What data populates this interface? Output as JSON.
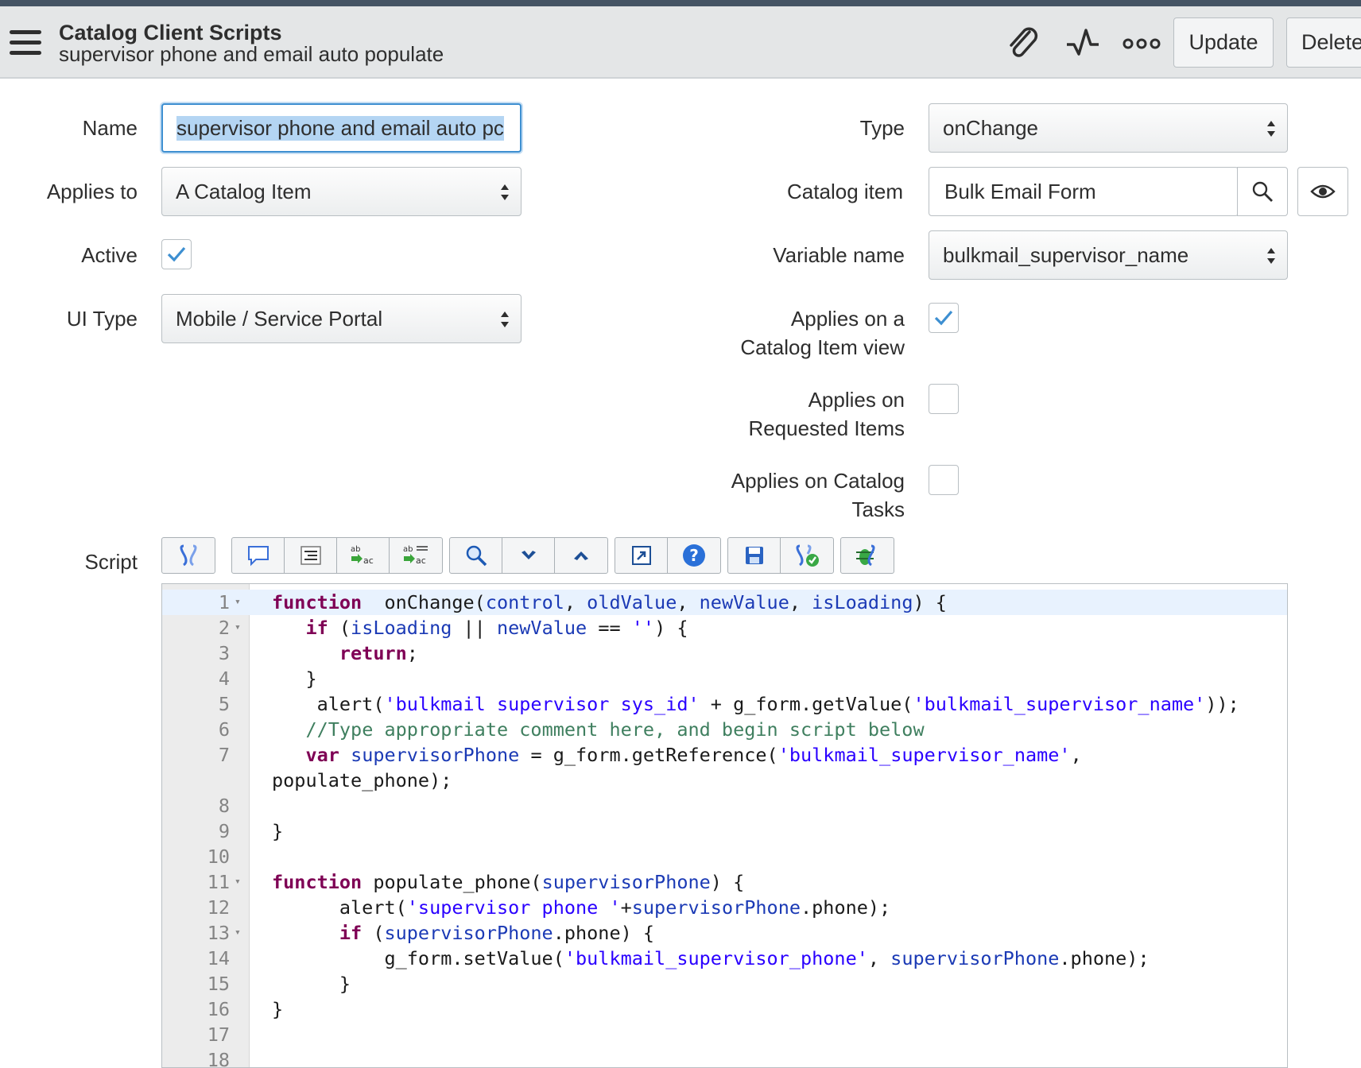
{
  "header": {
    "title": "Catalog Client Scripts",
    "subtitle": "supervisor phone and email auto populate",
    "update_label": "Update",
    "delete_label": "Delete",
    "icons": [
      "menu-icon",
      "paperclip-icon",
      "activity-icon",
      "more-options-icon"
    ]
  },
  "form": {
    "name": {
      "label": "Name",
      "value": "supervisor phone and email auto pc"
    },
    "applies_to": {
      "label": "Applies to",
      "value": "A Catalog Item"
    },
    "active": {
      "label": "Active",
      "checked": true
    },
    "ui_type": {
      "label": "UI Type",
      "value": "Mobile / Service Portal"
    },
    "type": {
      "label": "Type",
      "value": "onChange"
    },
    "catalog_item": {
      "label": "Catalog item",
      "value": "Bulk Email Form"
    },
    "variable_name": {
      "label": "Variable name",
      "value": "bulkmail_supervisor_name"
    },
    "applies_catalog_item_view": {
      "label_line1": "Applies on a",
      "label_line2": "Catalog Item view",
      "checked": true
    },
    "applies_requested_items": {
      "label_line1": "Applies on",
      "label_line2": "Requested Items",
      "checked": false
    },
    "applies_catalog_tasks": {
      "label_line1": "Applies on Catalog",
      "label_line2": "Tasks",
      "checked": false
    },
    "script_label": "Script"
  },
  "accent_color": "#3d8fd1",
  "toolbar_icons": [
    [
      "format-code-icon"
    ],
    [
      "comment-icon",
      "indent-icon",
      "replace-icon",
      "replace-all-icon"
    ],
    [
      "search-icon",
      "next-icon",
      "previous-icon"
    ],
    [
      "fullscreen-icon",
      "help-icon"
    ],
    [
      "save-icon",
      "syntax-check-icon"
    ],
    [
      "debug-icon"
    ]
  ],
  "code": {
    "lines": [
      {
        "n": "1",
        "fold": true,
        "hl": true,
        "tokens": [
          [
            "kw",
            "function"
          ],
          [
            "",
            "  onChange("
          ],
          [
            "var",
            "control"
          ],
          [
            "",
            ", "
          ],
          [
            "var",
            "oldValue"
          ],
          [
            "",
            ", "
          ],
          [
            "var",
            "newValue"
          ],
          [
            "",
            ", "
          ],
          [
            "var",
            "isLoading"
          ],
          [
            "",
            ") {"
          ]
        ]
      },
      {
        "n": "2",
        "fold": true,
        "tokens": [
          [
            "",
            "   "
          ],
          [
            "kw",
            "if"
          ],
          [
            "",
            " ("
          ],
          [
            "var",
            "isLoading"
          ],
          [
            "",
            " || "
          ],
          [
            "var",
            "newValue"
          ],
          [
            "",
            " == "
          ],
          [
            "str",
            "''"
          ],
          [
            "",
            ") {"
          ]
        ]
      },
      {
        "n": "3",
        "tokens": [
          [
            "",
            "      "
          ],
          [
            "kw",
            "return"
          ],
          [
            "",
            ";"
          ]
        ]
      },
      {
        "n": "4",
        "tokens": [
          [
            "",
            "   }"
          ]
        ]
      },
      {
        "n": "5",
        "tokens": [
          [
            "",
            "    alert("
          ],
          [
            "str",
            "'bulkmail supervisor sys_id'"
          ],
          [
            "",
            " + g_form.getValue("
          ],
          [
            "str",
            "'bulkmail_supervisor_name'"
          ],
          [
            "",
            "));"
          ]
        ]
      },
      {
        "n": "6",
        "tokens": [
          [
            "",
            "   "
          ],
          [
            "cm",
            "//Type appropriate comment here, and begin script below"
          ]
        ]
      },
      {
        "n": "7",
        "tokens": [
          [
            "",
            "   "
          ],
          [
            "kw",
            "var"
          ],
          [
            "",
            " "
          ],
          [
            "var",
            "supervisorPhone"
          ],
          [
            "",
            " = g_form.getReference("
          ],
          [
            "str",
            "'bulkmail_supervisor_name'"
          ],
          [
            "",
            ","
          ]
        ]
      },
      {
        "n": "",
        "tokens": [
          [
            "",
            "populate_phone);"
          ]
        ]
      },
      {
        "n": "8",
        "tokens": []
      },
      {
        "n": "9",
        "tokens": [
          [
            "",
            "}"
          ]
        ]
      },
      {
        "n": "10",
        "tokens": []
      },
      {
        "n": "11",
        "fold": true,
        "tokens": [
          [
            "kw",
            "function"
          ],
          [
            "",
            " populate_phone("
          ],
          [
            "var",
            "supervisorPhone"
          ],
          [
            "",
            ") {"
          ]
        ]
      },
      {
        "n": "12",
        "tokens": [
          [
            "",
            "      alert("
          ],
          [
            "str",
            "'supervisor phone '"
          ],
          [
            "",
            "+"
          ],
          [
            "var",
            "supervisorPhone"
          ],
          [
            "",
            ".phone);"
          ]
        ]
      },
      {
        "n": "13",
        "fold": true,
        "tokens": [
          [
            "",
            "      "
          ],
          [
            "kw",
            "if"
          ],
          [
            "",
            " ("
          ],
          [
            "var",
            "supervisorPhone"
          ],
          [
            "",
            ".phone) {"
          ]
        ]
      },
      {
        "n": "14",
        "tokens": [
          [
            "",
            "          g_form.setValue("
          ],
          [
            "str",
            "'bulkmail_supervisor_phone'"
          ],
          [
            "",
            ", "
          ],
          [
            "var",
            "supervisorPhone"
          ],
          [
            "",
            ".phone);"
          ]
        ]
      },
      {
        "n": "15",
        "tokens": [
          [
            "",
            "      }"
          ]
        ]
      },
      {
        "n": "16",
        "tokens": [
          [
            "",
            "}"
          ]
        ]
      },
      {
        "n": "17",
        "tokens": []
      },
      {
        "n": "18",
        "tokens": []
      }
    ]
  }
}
